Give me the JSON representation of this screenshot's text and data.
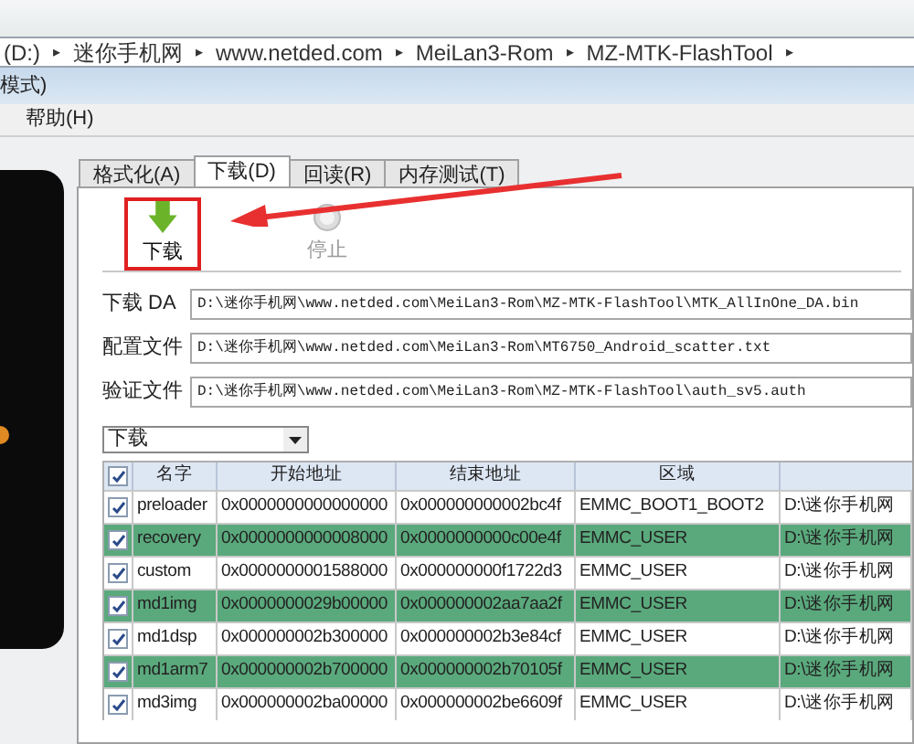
{
  "address_bar": {
    "segments": [
      "(D:)",
      "迷你手机网",
      "www.netded.com",
      "MeiLan3-Rom",
      "MZ-MTK-FlashTool"
    ],
    "separator": "▸"
  },
  "window": {
    "title": "模式)"
  },
  "menu": [
    "帮助(H)"
  ],
  "tabs": [
    {
      "label": "格式化(A)",
      "selected": false
    },
    {
      "label": "下载(D)",
      "selected": true
    },
    {
      "label": "回读(R)",
      "selected": false
    },
    {
      "label": "内存测试(T)",
      "selected": false
    }
  ],
  "toolbar": [
    {
      "kind": "download",
      "label": "下载",
      "disabled": false,
      "highlighted": true
    },
    {
      "kind": "stop",
      "label": "停止",
      "disabled": true,
      "highlighted": false
    }
  ],
  "fields": [
    {
      "label": "下载 DA",
      "value": "D:\\迷你手机网\\www.netded.com\\MeiLan3-Rom\\MZ-MTK-FlashTool\\MTK_AllInOne_DA.bin"
    },
    {
      "label": "配置文件",
      "value": "D:\\迷你手机网\\www.netded.com\\MeiLan3-Rom\\MT6750_Android_scatter.txt"
    },
    {
      "label": "验证文件",
      "value": "D:\\迷你手机网\\www.netded.com\\MeiLan3-Rom\\MZ-MTK-FlashTool\\auth_sv5.auth"
    }
  ],
  "mode_select": {
    "value": "下载"
  },
  "table": {
    "all_checked": true,
    "columns": [
      "名字",
      "开始地址",
      "结束地址",
      "区域"
    ],
    "rows": [
      {
        "checked": true,
        "cells": [
          "preloader",
          "0x0000000000000000",
          "0x000000000002bc4f",
          "EMMC_BOOT1_BOOT2",
          "D:\\迷你手机网"
        ]
      },
      {
        "checked": true,
        "cells": [
          "recovery",
          "0x0000000000008000",
          "0x0000000000c00e4f",
          "EMMC_USER",
          "D:\\迷你手机网"
        ]
      },
      {
        "checked": true,
        "cells": [
          "custom",
          "0x0000000001588000",
          "0x000000000f1722d3",
          "EMMC_USER",
          "D:\\迷你手机网"
        ]
      },
      {
        "checked": true,
        "cells": [
          "md1img",
          "0x0000000029b00000",
          "0x000000002aa7aa2f",
          "EMMC_USER",
          "D:\\迷你手机网"
        ]
      },
      {
        "checked": true,
        "cells": [
          "md1dsp",
          "0x000000002b300000",
          "0x000000002b3e84cf",
          "EMMC_USER",
          "D:\\迷你手机网"
        ]
      },
      {
        "checked": true,
        "cells": [
          "md1arm7",
          "0x000000002b700000",
          "0x000000002b70105f",
          "EMMC_USER",
          "D:\\迷你手机网"
        ]
      },
      {
        "checked": true,
        "cells": [
          "md3img",
          "0x000000002ba00000",
          "0x000000002be6609f",
          "EMMC_USER",
          "D:\\迷你手机网"
        ]
      }
    ]
  }
}
